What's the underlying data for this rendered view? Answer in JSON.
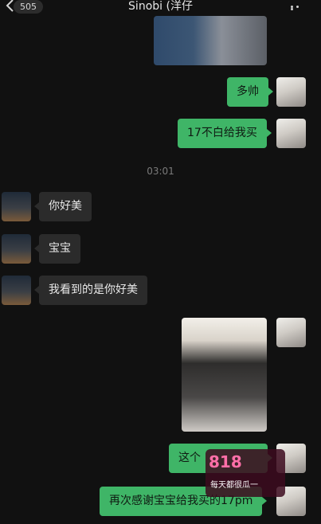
{
  "header": {
    "back_count": "505",
    "title": "Sinobi (洋仔"
  },
  "time_divider": "03:01",
  "messages": [
    {
      "side": "out",
      "type": "image"
    },
    {
      "side": "out",
      "type": "text",
      "text": "多帅"
    },
    {
      "side": "out",
      "type": "text",
      "text": "17不白给我买"
    },
    {
      "side": "in",
      "type": "text",
      "text": "你好美"
    },
    {
      "side": "in",
      "type": "text",
      "text": "宝宝"
    },
    {
      "side": "in",
      "type": "text",
      "text": "我看到的是你好美"
    },
    {
      "side": "out",
      "type": "image"
    },
    {
      "side": "out",
      "type": "text",
      "text": "这个"
    },
    {
      "side": "out",
      "type": "text",
      "text": "再次感谢宝宝给我买的17pm"
    }
  ],
  "watermark": {
    "brand": "818",
    "tagline": "每天都很瓜一"
  },
  "colors": {
    "background": "#111111",
    "outgoing": "#3fb567",
    "incoming": "#2b2b2b"
  }
}
